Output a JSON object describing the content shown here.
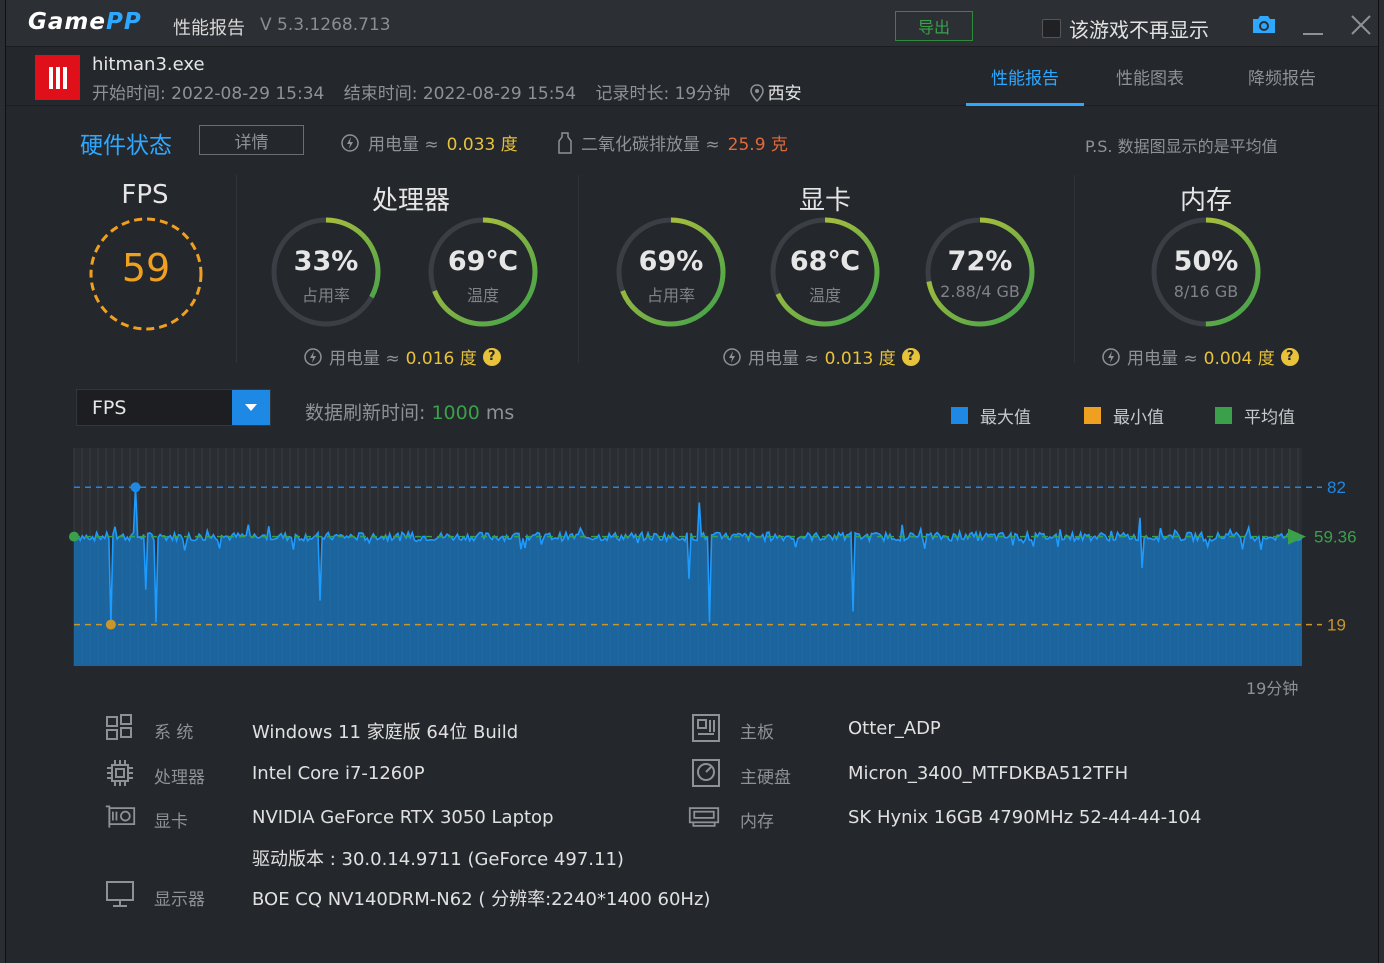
{
  "titlebar": {
    "logo_a": "Game",
    "logo_b": "PP",
    "title": "性能报告",
    "version": "V 5.3.1268.713",
    "export_label": "导出",
    "nodisplay_label": "该游戏不再显示"
  },
  "game": {
    "exe": "hitman3.exe",
    "start": "开始时间: 2022-08-29 15:34",
    "end": "结束时间: 2022-08-29 15:54",
    "duration": "记录时长: 19分钟",
    "location": "西安"
  },
  "tabs": [
    {
      "label": "性能报告",
      "active": true
    },
    {
      "label": "性能图表",
      "active": false
    },
    {
      "label": "降频报告",
      "active": false
    }
  ],
  "hw": {
    "title": "硬件状态",
    "detail_label": "详情",
    "power_label": "用电量 ≈",
    "power_value": "0.033 度",
    "co2_label": "二氧化碳排放量 ≈",
    "co2_value": "25.9 克",
    "ps": "P.S. 数据图显示的是平均值"
  },
  "fps": {
    "title": "FPS",
    "value": "59"
  },
  "cpu": {
    "title": "处理器",
    "usage": {
      "value": "33%",
      "label": "占用率",
      "fraction": 0.33
    },
    "temp": {
      "value": "69℃",
      "label": "温度",
      "fraction": 0.69
    },
    "power_label": "用电量 ≈",
    "power_value": "0.016 度"
  },
  "gpu": {
    "title": "显卡",
    "usage": {
      "value": "69%",
      "label": "占用率",
      "fraction": 0.69
    },
    "temp": {
      "value": "68℃",
      "label": "温度",
      "fraction": 0.68
    },
    "vram": {
      "value": "72%",
      "label": "2.88/4 GB",
      "fraction": 0.72
    },
    "power_label": "用电量 ≈",
    "power_value": "0.013 度"
  },
  "mem": {
    "title": "内存",
    "usage": {
      "value": "50%",
      "label": "8/16 GB",
      "fraction": 0.5
    },
    "power_label": "用电量 ≈",
    "power_value": "0.004 度"
  },
  "chart_controls": {
    "metric": "FPS",
    "refresh_label": "数据刷新时间:",
    "refresh_value": "1000",
    "refresh_unit": "ms",
    "legend": [
      {
        "label": "最大值",
        "color": "#1e88e5"
      },
      {
        "label": "最小值",
        "color": "#f0a020"
      },
      {
        "label": "平均值",
        "color": "#3aa04a"
      }
    ],
    "x_end_label": "19分钟"
  },
  "chart_data": {
    "type": "area",
    "series": [
      {
        "values": []
      }
    ],
    "max": 82,
    "min": 19,
    "avg": 59.36,
    "max_label": "82",
    "min_label": "19",
    "avg_label": "59.36",
    "ylim": [
      0,
      100
    ],
    "duration_min": 19
  },
  "sysinfo": {
    "system_label": "系  统",
    "system_value": "Windows 11 家庭版 64位   Build",
    "cpu_label": "处理器",
    "cpu_value": "Intel Core i7-1260P",
    "gpu_label": "显卡",
    "gpu_value": "NVIDIA GeForce RTX 3050 Laptop",
    "driver_value": "驱动版本 : 30.0.14.9711 (GeForce 497.11)",
    "display_label": "显示器",
    "display_value": "BOE CQ NV140DRM-N62 ( 分辨率:2240*1400 60Hz)",
    "board_label": "主板",
    "board_value": "Otter_ADP",
    "disk_label": "主硬盘",
    "disk_value": "Micron_3400_MTFDKBA512TFH",
    "ram_label": "内存",
    "ram_value": "SK Hynix 16GB 4790MHz 52-44-44-104"
  },
  "colors": {
    "accent": "#2ea8ff",
    "gauge_track": "#3b3f45",
    "gauge_arc_green": "#3aa04a",
    "gauge_arc_yellow": "#c8c63a",
    "fps_ring": "#f0a020"
  }
}
